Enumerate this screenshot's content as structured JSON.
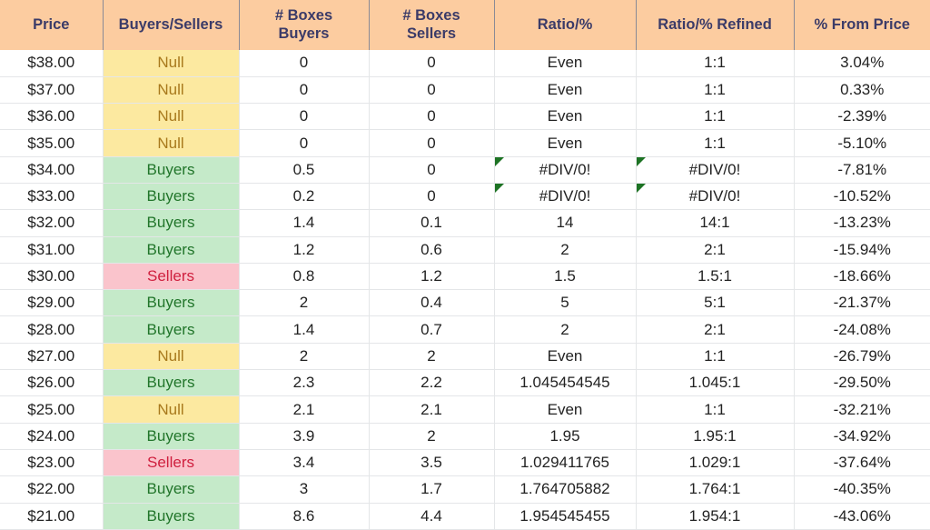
{
  "table": {
    "columns": [
      {
        "key": "price",
        "label": "Price"
      },
      {
        "key": "bs",
        "label": "Buyers/Sellers"
      },
      {
        "key": "bb",
        "label": "# Boxes\nBuyers"
      },
      {
        "key": "sb",
        "label": "# Boxes\nSellers"
      },
      {
        "key": "ratio",
        "label": "Ratio/%"
      },
      {
        "key": "refined",
        "label": "Ratio/% Refined"
      },
      {
        "key": "pct",
        "label": "% From Price"
      }
    ],
    "colors": {
      "header_bg": "#FCCCA0",
      "header_text": "#3B3B68",
      "null_bg": "#FCE9A0",
      "null_text": "#A8791C",
      "buyers_bg": "#C5EAC9",
      "buyers_text": "#21752A",
      "sellers_bg": "#FAC4CC",
      "sellers_text": "#CF1F3E",
      "error_marker": "#1D7324",
      "gridline": "#E4E6E8"
    },
    "rows": [
      {
        "price": "$38.00",
        "bs": "Null",
        "bs_state": "null",
        "bb": "0",
        "sb": "0",
        "ratio": "Even",
        "ratio_error": false,
        "refined": "1:1",
        "refined_error": false,
        "pct": "3.04%"
      },
      {
        "price": "$37.00",
        "bs": "Null",
        "bs_state": "null",
        "bb": "0",
        "sb": "0",
        "ratio": "Even",
        "ratio_error": false,
        "refined": "1:1",
        "refined_error": false,
        "pct": "0.33%"
      },
      {
        "price": "$36.00",
        "bs": "Null",
        "bs_state": "null",
        "bb": "0",
        "sb": "0",
        "ratio": "Even",
        "ratio_error": false,
        "refined": "1:1",
        "refined_error": false,
        "pct": "-2.39%"
      },
      {
        "price": "$35.00",
        "bs": "Null",
        "bs_state": "null",
        "bb": "0",
        "sb": "0",
        "ratio": "Even",
        "ratio_error": false,
        "refined": "1:1",
        "refined_error": false,
        "pct": "-5.10%"
      },
      {
        "price": "$34.00",
        "bs": "Buyers",
        "bs_state": "buyers",
        "bb": "0.5",
        "sb": "0",
        "ratio": "#DIV/0!",
        "ratio_error": true,
        "refined": "#DIV/0!",
        "refined_error": true,
        "pct": "-7.81%"
      },
      {
        "price": "$33.00",
        "bs": "Buyers",
        "bs_state": "buyers",
        "bb": "0.2",
        "sb": "0",
        "ratio": "#DIV/0!",
        "ratio_error": true,
        "refined": "#DIV/0!",
        "refined_error": true,
        "pct": "-10.52%"
      },
      {
        "price": "$32.00",
        "bs": "Buyers",
        "bs_state": "buyers",
        "bb": "1.4",
        "sb": "0.1",
        "ratio": "14",
        "ratio_error": false,
        "refined": "14:1",
        "refined_error": false,
        "pct": "-13.23%"
      },
      {
        "price": "$31.00",
        "bs": "Buyers",
        "bs_state": "buyers",
        "bb": "1.2",
        "sb": "0.6",
        "ratio": "2",
        "ratio_error": false,
        "refined": "2:1",
        "refined_error": false,
        "pct": "-15.94%"
      },
      {
        "price": "$30.00",
        "bs": "Sellers",
        "bs_state": "sellers",
        "bb": "0.8",
        "sb": "1.2",
        "ratio": "1.5",
        "ratio_error": false,
        "refined": "1.5:1",
        "refined_error": false,
        "pct": "-18.66%"
      },
      {
        "price": "$29.00",
        "bs": "Buyers",
        "bs_state": "buyers",
        "bb": "2",
        "sb": "0.4",
        "ratio": "5",
        "ratio_error": false,
        "refined": "5:1",
        "refined_error": false,
        "pct": "-21.37%"
      },
      {
        "price": "$28.00",
        "bs": "Buyers",
        "bs_state": "buyers",
        "bb": "1.4",
        "sb": "0.7",
        "ratio": "2",
        "ratio_error": false,
        "refined": "2:1",
        "refined_error": false,
        "pct": "-24.08%"
      },
      {
        "price": "$27.00",
        "bs": "Null",
        "bs_state": "null",
        "bb": "2",
        "sb": "2",
        "ratio": "Even",
        "ratio_error": false,
        "refined": "1:1",
        "refined_error": false,
        "pct": "-26.79%"
      },
      {
        "price": "$26.00",
        "bs": "Buyers",
        "bs_state": "buyers",
        "bb": "2.3",
        "sb": "2.2",
        "ratio": "1.045454545",
        "ratio_error": false,
        "refined": "1.045:1",
        "refined_error": false,
        "pct": "-29.50%"
      },
      {
        "price": "$25.00",
        "bs": "Null",
        "bs_state": "null",
        "bb": "2.1",
        "sb": "2.1",
        "ratio": "Even",
        "ratio_error": false,
        "refined": "1:1",
        "refined_error": false,
        "pct": "-32.21%"
      },
      {
        "price": "$24.00",
        "bs": "Buyers",
        "bs_state": "buyers",
        "bb": "3.9",
        "sb": "2",
        "ratio": "1.95",
        "ratio_error": false,
        "refined": "1.95:1",
        "refined_error": false,
        "pct": "-34.92%"
      },
      {
        "price": "$23.00",
        "bs": "Sellers",
        "bs_state": "sellers",
        "bb": "3.4",
        "sb": "3.5",
        "ratio": "1.029411765",
        "ratio_error": false,
        "refined": "1.029:1",
        "refined_error": false,
        "pct": "-37.64%"
      },
      {
        "price": "$22.00",
        "bs": "Buyers",
        "bs_state": "buyers",
        "bb": "3",
        "sb": "1.7",
        "ratio": "1.764705882",
        "ratio_error": false,
        "refined": "1.764:1",
        "refined_error": false,
        "pct": "-40.35%"
      },
      {
        "price": "$21.00",
        "bs": "Buyers",
        "bs_state": "buyers",
        "bb": "8.6",
        "sb": "4.4",
        "ratio": "1.954545455",
        "ratio_error": false,
        "refined": "1.954:1",
        "refined_error": false,
        "pct": "-43.06%"
      }
    ]
  }
}
